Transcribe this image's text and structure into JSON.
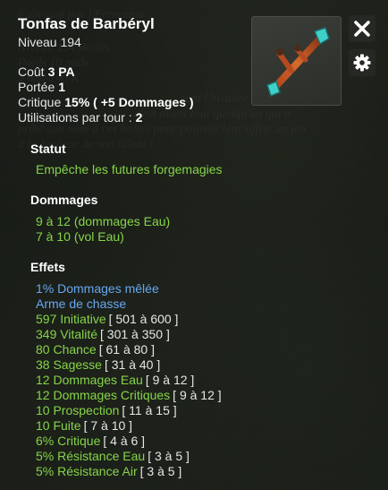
{
  "item": {
    "name": "Tonfas de Barbéryl",
    "level_label": "Niveau",
    "level_value": "194",
    "cost_label": "Coût",
    "cost_value": "3 PA",
    "range_label": "Portée",
    "range_value": "1",
    "crit_label": "Critique",
    "crit_value": "15% ( +5 Dommages )",
    "uses_label": "Utilisations par tour :",
    "uses_value": "2"
  },
  "status": {
    "title": "Statut",
    "text": "Empêche les futures forgemagies"
  },
  "damage": {
    "title": "Dommages",
    "lines": [
      {
        "text": "9 à 12 (dommages Eau)"
      },
      {
        "text": "7 à 10 (vol Eau)"
      }
    ]
  },
  "effects": {
    "title": "Effets",
    "blue_lines": [
      {
        "text": "1% Dommages mêlée"
      },
      {
        "text": "Arme de chasse"
      }
    ],
    "lines": [
      {
        "text": "597 Initiative",
        "range": "[ 501 à 600 ]"
      },
      {
        "text": "349 Vitalité",
        "range": "[ 301 à 350 ]"
      },
      {
        "text": "80 Chance",
        "range": "[ 61 à 80 ]"
      },
      {
        "text": "38 Sagesse",
        "range": "[ 31 à 40 ]"
      },
      {
        "text": "12 Dommages Eau",
        "range": "[ 9 à 12 ]"
      },
      {
        "text": "12 Dommages Critiques",
        "range": "[ 9 à 12 ]"
      },
      {
        "text": "10 Prospection",
        "range": "[ 11 à 15 ]"
      },
      {
        "text": "10 Fuite",
        "range": "[ 7 à 10 ]"
      },
      {
        "text": "6% Critique",
        "range": "[ 4 à 6 ]"
      },
      {
        "text": "5% Résistance Eau",
        "range": "[ 3 à 5 ]"
      },
      {
        "text": "5% Résistance Air",
        "range": "[ 3 à 5 ]"
      }
    ]
  },
  "background_text": {
    "lines": [
      "Fabriqué par l'Errorama",
      "Niveau 194 Bottes",
      "Poids 10 pods",
      "3 650 140 K",
      "dont l'histoire renferme",
      "c'est avant tout quelqu'un qui a",
      "prêté son nom à ces bottes pour pouvoir leur offrir un jeu",
      "à la hauteur de son talent !"
    ]
  },
  "icons": {
    "close": "close-icon",
    "settings": "gear-icon",
    "item": "tonfa-weapon-icon"
  },
  "colors": {
    "effect_green": "#86d449",
    "effect_blue": "#66a8f0"
  }
}
